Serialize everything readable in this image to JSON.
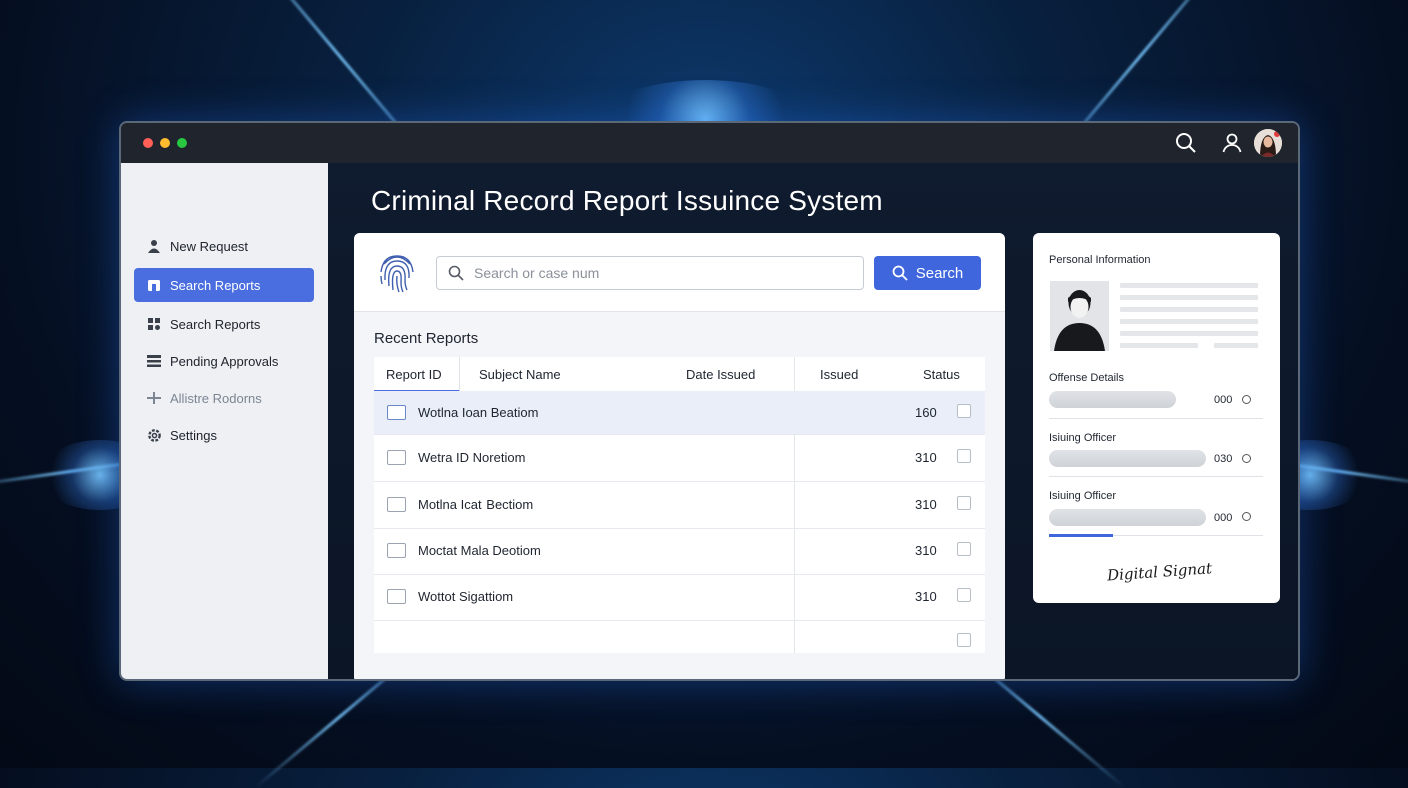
{
  "window": {
    "controls": [
      "close",
      "minimize",
      "maximize"
    ],
    "toolbar_icons": [
      "search-icon",
      "user-icon",
      "avatar"
    ]
  },
  "sidebar": {
    "items": [
      {
        "label": "New Request",
        "icon": "user-icon",
        "state": "normal"
      },
      {
        "label": "Search Reports",
        "icon": "folder-icon",
        "state": "active"
      },
      {
        "label": "Search Reports",
        "icon": "grid-icon",
        "state": "normal"
      },
      {
        "label": "Pending Approvals",
        "icon": "list-icon",
        "state": "normal"
      },
      {
        "label": "Allistre Rodorns",
        "icon": "filter-icon",
        "state": "muted"
      },
      {
        "label": "Settings",
        "icon": "gear-icon",
        "state": "normal"
      }
    ]
  },
  "main": {
    "title": "Criminal Record Report Issuince System",
    "search": {
      "placeholder": "Search or case num",
      "value": "",
      "button_label": "Search"
    },
    "recent": {
      "title": "Recent Reports",
      "columns": [
        "Report ID",
        "Subject Name",
        "Date Issued",
        "Ιssued",
        "Status"
      ],
      "rows": [
        {
          "name": "Wotlna Ioan Beatiom",
          "num": "160",
          "selected": true
        },
        {
          "name": "Wetra ID Noretiom",
          "num": "310",
          "selected": false
        },
        {
          "name": "Motlna Icat  Bectiom",
          "num": "310",
          "selected": false
        },
        {
          "name": "Moctat Mala Deotiom",
          "num": "310",
          "selected": false
        },
        {
          "name": "Wottot Sigattiom",
          "num": "310",
          "selected": false
        },
        {
          "name": "",
          "num": "",
          "selected": false
        }
      ]
    }
  },
  "side_panel": {
    "personal_info_label": "Personal Information",
    "offense_label": "Offense Details",
    "offense_value": "000",
    "officer1_label": "Isiuing Officer",
    "officer1_value": "030",
    "officer2_label": "Isiuing Officer",
    "officer2_value": "000",
    "progress": 0.3,
    "signature": "Digital Signature"
  },
  "colors": {
    "accent": "#4a6ee0",
    "button": "#3f66dc",
    "titlebar": "#1f242d",
    "close": "#ff5f57",
    "minimize": "#febc2e",
    "maximize": "#28c840"
  }
}
